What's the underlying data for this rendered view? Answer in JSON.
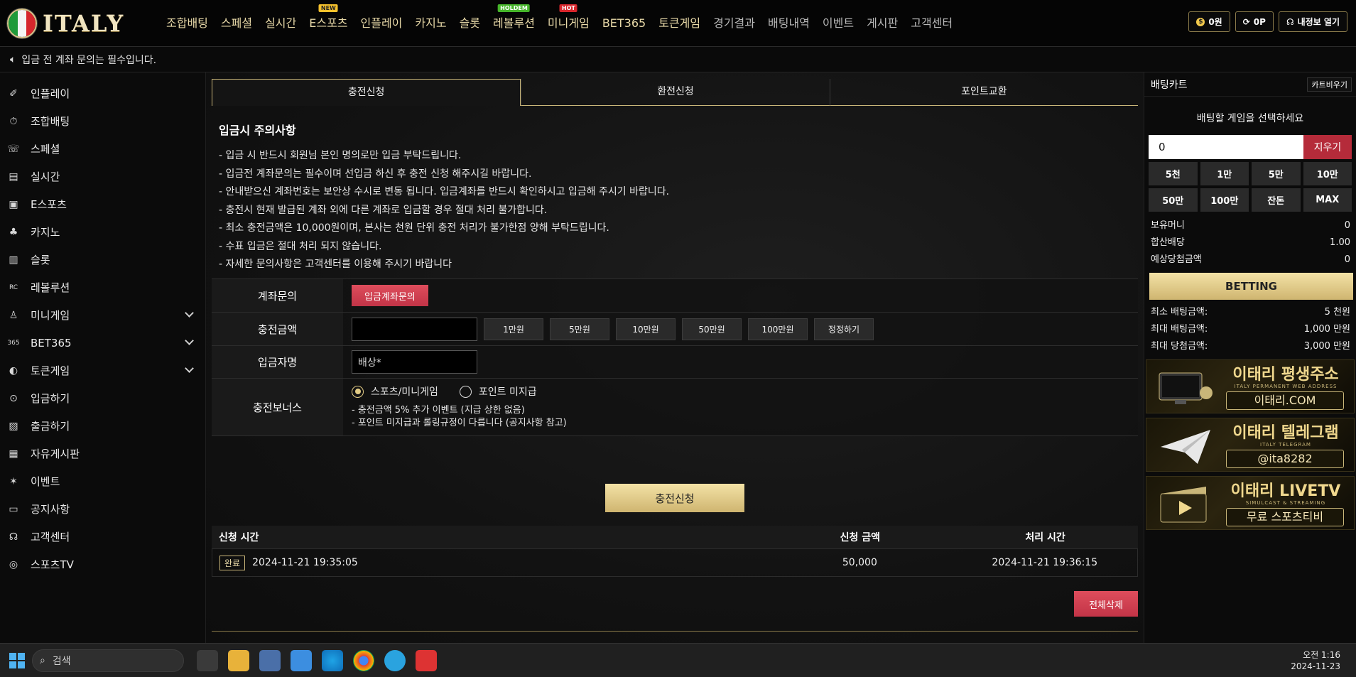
{
  "logo": {
    "text": "ITALY"
  },
  "nav": [
    {
      "label": "조합배팅",
      "badge": ""
    },
    {
      "label": "스페셜",
      "badge": ""
    },
    {
      "label": "실시간",
      "badge": ""
    },
    {
      "label": "E스포츠",
      "badge": "NEW"
    },
    {
      "label": "인플레이",
      "badge": ""
    },
    {
      "label": "카지노",
      "badge": ""
    },
    {
      "label": "슬롯",
      "badge": ""
    },
    {
      "label": "레볼루션",
      "badge": "HOLDEM"
    },
    {
      "label": "미니게임",
      "badge": "HOT"
    },
    {
      "label": "BET365",
      "badge": ""
    },
    {
      "label": "토큰게임",
      "badge": ""
    },
    {
      "label": "경기결과",
      "badge": ""
    },
    {
      "label": "배팅내역",
      "badge": ""
    },
    {
      "label": "이벤트",
      "badge": ""
    },
    {
      "label": "게시판",
      "badge": ""
    },
    {
      "label": "고객센터",
      "badge": ""
    }
  ],
  "topright": {
    "balance": "0원",
    "points": "0P",
    "myinfo": "내정보 열기"
  },
  "notice": "입금 전 계좌 문의는 필수입니다.",
  "sidebar": [
    {
      "label": "인플레이",
      "icon": "✐",
      "expand": false
    },
    {
      "label": "조합배팅",
      "icon": "⏱",
      "expand": false
    },
    {
      "label": "스페셜",
      "icon": "☏",
      "expand": false
    },
    {
      "label": "실시간",
      "icon": "▤",
      "expand": false
    },
    {
      "label": "E스포츠",
      "icon": "▣",
      "expand": false
    },
    {
      "label": "카지노",
      "icon": "♣",
      "expand": false
    },
    {
      "label": "슬롯",
      "icon": "▥",
      "expand": false
    },
    {
      "label": "레볼루션",
      "icon": "RC",
      "expand": false
    },
    {
      "label": "미니게임",
      "icon": "♙",
      "expand": true
    },
    {
      "label": "BET365",
      "icon": "365",
      "expand": true
    },
    {
      "label": "토큰게임",
      "icon": "◐",
      "expand": true
    },
    {
      "label": "입금하기",
      "icon": "⊙",
      "expand": false
    },
    {
      "label": "출금하기",
      "icon": "▨",
      "expand": false
    },
    {
      "label": "자유게시판",
      "icon": "▦",
      "expand": false
    },
    {
      "label": "이벤트",
      "icon": "✶",
      "expand": false
    },
    {
      "label": "공지사항",
      "icon": "▭",
      "expand": false
    },
    {
      "label": "고객센터",
      "icon": "☊",
      "expand": false
    },
    {
      "label": "스포츠TV",
      "icon": "◎",
      "expand": false
    }
  ],
  "tabs": [
    "충전신청",
    "환전신청",
    "포인트교환"
  ],
  "caution": {
    "title": "입금시 주의사항",
    "lines": [
      "- 입금 시 반드시 회원님 본인 명의로만 입금 부탁드립니다.",
      "- 입금전 계좌문의는 필수이며 선입금 하신 후 충전 신청 해주시길 바랍니다.",
      "- 안내받으신 계좌번호는 보안상 수시로 변동 됩니다. 입금계좌를 반드시 확인하시고 입금해 주시기 바랍니다.",
      "- 충전시 현재 발급된 계좌 외에 다른 계좌로 입금할 경우 절대 처리 불가합니다.",
      "- 최소 충전금액은 10,000원이며, 본사는 천원 단위 충전 처리가 불가한점 양해 부탁드립니다.",
      "- 수표 입금은 절대 처리 되지 않습니다.",
      "- 자세한 문의사항은 고객센터를 이용해 주시기 바랍니다"
    ]
  },
  "form": {
    "account_label": "계좌문의",
    "account_btn": "입금계좌문의",
    "amount_label": "충전금액",
    "amount_value": "",
    "amount_buttons": [
      "1만원",
      "5만원",
      "10만원",
      "50만원",
      "100만원",
      "정정하기"
    ],
    "name_label": "입금자명",
    "name_value": "배상*",
    "bonus_label": "충전보너스",
    "bonus_options": [
      "스포츠/미니게임",
      "포인트 미지급"
    ],
    "bonus_notes": [
      "- 충전금액 5% 추가 이벤트 (지급 상한 없음)",
      "- 포인트 미지급과 롤링규정이 다릅니다 (공지사항 참고)"
    ],
    "submit": "충전신청"
  },
  "history": {
    "headers": [
      "신청 시간",
      "신청 금액",
      "처리 시간"
    ],
    "rows": [
      {
        "status": "완료",
        "requested": "2024-11-21 19:35:05",
        "amount": "50,000",
        "processed": "2024-11-21 19:36:15"
      }
    ],
    "delete_all": "전체삭제"
  },
  "betslip": {
    "title": "배팅카트",
    "clear_cart": "카트비우기",
    "message": "배팅할 게임을 선택하세요",
    "amount": "0",
    "clear_btn": "지우기",
    "chips": [
      "5천",
      "1만",
      "5만",
      "10만",
      "50만",
      "100만",
      "잔돈",
      "MAX"
    ],
    "stats": [
      {
        "k": "보유머니",
        "v": "0"
      },
      {
        "k": "합산배당",
        "v": "1.00"
      },
      {
        "k": "예상당첨금액",
        "v": "0"
      }
    ],
    "bet_btn": "BETTING",
    "limits": [
      {
        "k": "최소 배팅금액:",
        "v": "5 천원"
      },
      {
        "k": "최대 배팅금액:",
        "v": "1,000 만원"
      },
      {
        "k": "최대 당첨금액:",
        "v": "3,000 만원"
      }
    ]
  },
  "banners": [
    {
      "title": "이태리 평생주소",
      "sub": "ITALY PERMANENT WEB ADDRESS",
      "box": "이태리.COM"
    },
    {
      "title": "이태리 텔레그램",
      "sub": "ITALY TELEGRAM",
      "box": "@ita8282"
    },
    {
      "title": "이태리 LIVETV",
      "sub": "SIMULCAST & STREAMING",
      "box": "무료 스포츠티비"
    }
  ],
  "taskbar": {
    "search": "검색",
    "time": "오전 1:16",
    "date": "2024-11-23"
  },
  "colors": {
    "gold": "#c9b679",
    "red": "#c23447",
    "bg": "#0d0d0d"
  }
}
